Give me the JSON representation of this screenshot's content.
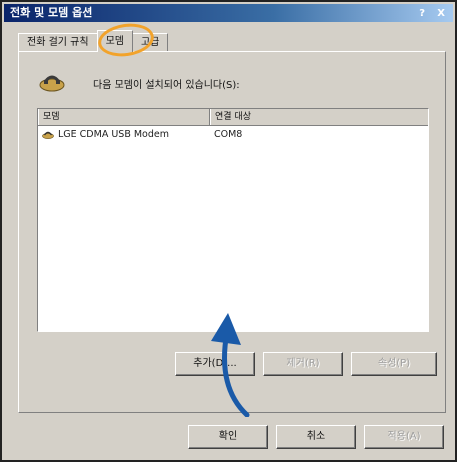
{
  "window": {
    "title": "전화 및 모뎀 옵션",
    "help_label": "?",
    "close_label": "X"
  },
  "tabs": [
    {
      "label": "전화 걸기 규칙"
    },
    {
      "label": "모뎀"
    },
    {
      "label": "고급"
    }
  ],
  "panel": {
    "info_text": "다음 모뎀이 설치되어 있습니다(S):",
    "columns": [
      "모뎀",
      "연결 대상"
    ],
    "rows": [
      {
        "modem": "LGE CDMA USB Modem",
        "attached_to": "COM8"
      }
    ],
    "buttons": {
      "add": "추가(D)...",
      "remove": "제거(R)",
      "properties": "속성(P)"
    }
  },
  "footer_buttons": {
    "ok": "확인",
    "cancel": "취소",
    "apply": "적용(A)"
  },
  "annotations": {
    "highlight_color": "#f2a32b",
    "arrow_color": "#1a5aa8"
  }
}
